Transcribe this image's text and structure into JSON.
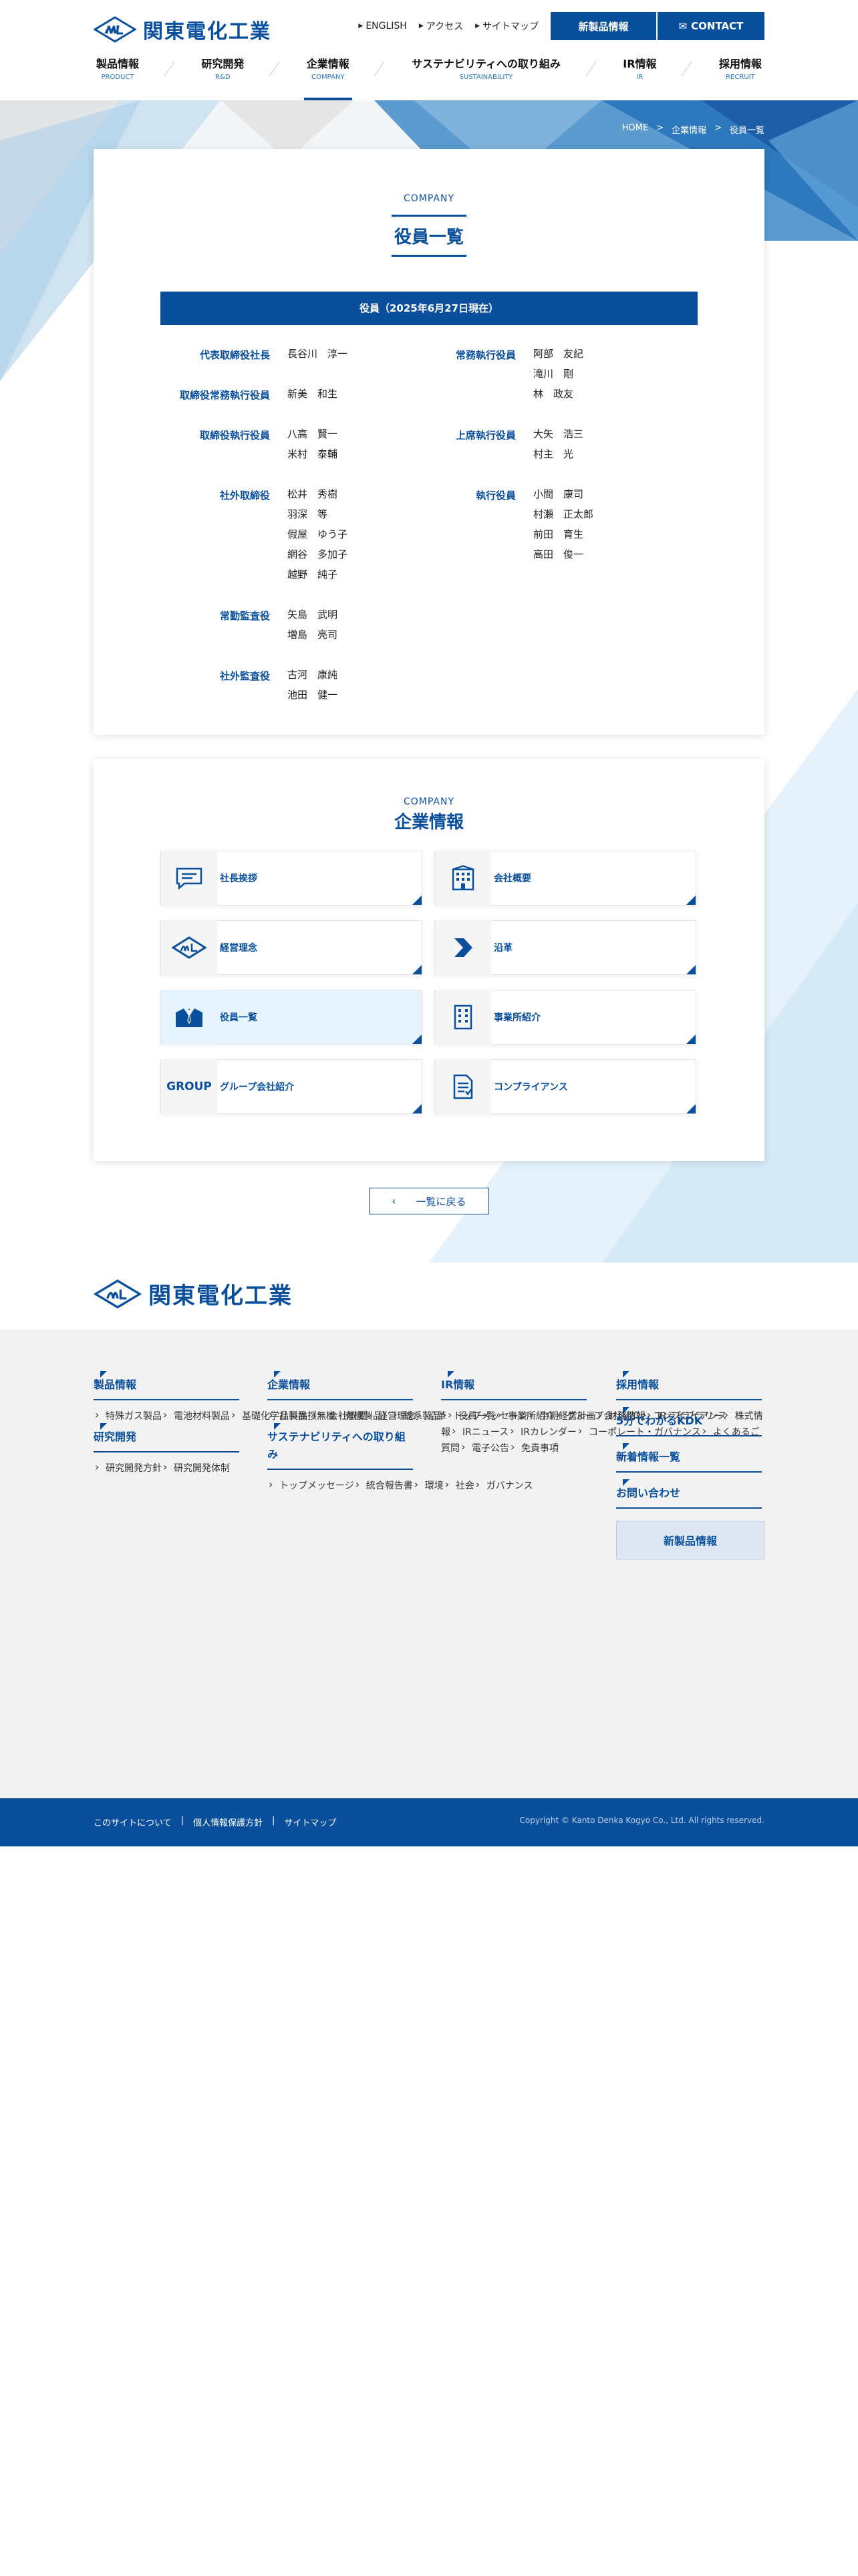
{
  "header": {
    "logo": "関東電化工業",
    "util": [
      "ENGLISH",
      "アクセス",
      "サイトマップ"
    ],
    "new_products": "新製品情報",
    "contact": "CONTACT",
    "nav": [
      {
        "jp": "製品情報",
        "en": "PRODUCT"
      },
      {
        "jp": "研究開発",
        "en": "R&D"
      },
      {
        "jp": "企業情報",
        "en": "COMPANY"
      },
      {
        "jp": "サステナビリティへの取り組み",
        "en": "SUSTAINABILITY"
      },
      {
        "jp": "IR情報",
        "en": "IR"
      },
      {
        "jp": "採用情報",
        "en": "RECRUIT"
      }
    ]
  },
  "breadcrumb": [
    "HOME",
    ">",
    "企業情報",
    ">",
    "役員一覧"
  ],
  "officers": {
    "kicker": "COMPANY",
    "title": "役員一覧",
    "bar": "役員（2025年6月27日現在）",
    "left": [
      {
        "role": "代表取締役社長",
        "names": [
          "長谷川　淳一"
        ]
      },
      {
        "role": "取締役常務執行役員",
        "names": [
          "新美　和生"
        ]
      },
      {
        "role": "取締役執行役員",
        "names": [
          "八高　賢一",
          "米村　泰輔"
        ]
      },
      {
        "role": "社外取締役",
        "names": [
          "松井　秀樹",
          "羽深　等",
          "假屋　ゆう子",
          "網谷　多加子",
          "越野　純子"
        ]
      },
      {
        "role": "常勤監査役",
        "names": [
          "矢島　武明",
          "増島　亮司"
        ]
      },
      {
        "role": "社外監査役",
        "names": [
          "古河　康純",
          "池田　健一"
        ]
      }
    ],
    "right": [
      {
        "role": "常務執行役員",
        "names": [
          "阿部　友紀",
          "滝川　剛",
          "林　政友"
        ]
      },
      {
        "role": "上席執行役員",
        "names": [
          "大矢　浩三",
          "村主　光"
        ]
      },
      {
        "role": "執行役員",
        "names": [
          "小間　康司",
          "村瀬　正太郎",
          "前田　育生",
          "高田　俊一"
        ]
      }
    ]
  },
  "company": {
    "kicker": "COMPANY",
    "title": "企業情報",
    "tiles": [
      {
        "label": "社長挨拶",
        "icon": "speech-icon"
      },
      {
        "label": "会社概要",
        "icon": "building-icon"
      },
      {
        "label": "経営理念",
        "icon": "logo-mark-icon"
      },
      {
        "label": "沿革",
        "icon": "arrow-chevron-icon"
      },
      {
        "label": "役員一覧",
        "icon": "suit-icon"
      },
      {
        "label": "事業所紹介",
        "icon": "office-building-icon"
      },
      {
        "label": "グループ会社紹介",
        "icon": "group-text-icon",
        "icon_text": "GROUP"
      },
      {
        "label": "コンプライアンス",
        "icon": "document-icon"
      }
    ],
    "back": "一覧に戻る"
  },
  "footer": {
    "logo": "関東電化工業",
    "col1": {
      "h1": "製品情報",
      "l1": [
        "特殊ガス製品",
        "電池材料製品",
        "基礎化学品製品（無機・有機製品）",
        "鉄系製品"
      ],
      "h2": "研究開発",
      "l2": [
        "研究開発方針",
        "研究開発体制"
      ]
    },
    "col2": {
      "h1": "企業情報",
      "l1": [
        "社長挨拶",
        "会社概要",
        "経営理念",
        "沿革",
        "役員一覧",
        "事業所紹介",
        "グループ会社紹介",
        "コンプライアンス"
      ],
      "h2": "サステナビリティへの取り組み",
      "l2": [
        "トップメッセージ",
        "統合報告書",
        "環境",
        "社会",
        "ガバナンス"
      ]
    },
    "col3": {
      "h1": "IR情報",
      "l1": [
        "トップメッセージ",
        "中期経営計画",
        "財務情報",
        "IRライブラリー",
        "株式情報",
        "IRニュース",
        "IRカレンダー",
        "コーポレート・ガバナンス",
        "よくあるご質問",
        "電子公告",
        "免責事項"
      ]
    },
    "col4": {
      "h": [
        "採用情報",
        "5分でわかるKDK",
        "新着情報一覧",
        "お問い合わせ"
      ],
      "btn": "新製品情報"
    },
    "bottom_links": [
      "このサイトについて",
      "個人情報保護方針",
      "サイトマップ"
    ],
    "copyright": "Copyright © Kanto Denka Kogyo Co., Ltd. All rights reserved."
  },
  "colors": {
    "brand": "#0a4f9c",
    "accent": "#2a78c8"
  }
}
